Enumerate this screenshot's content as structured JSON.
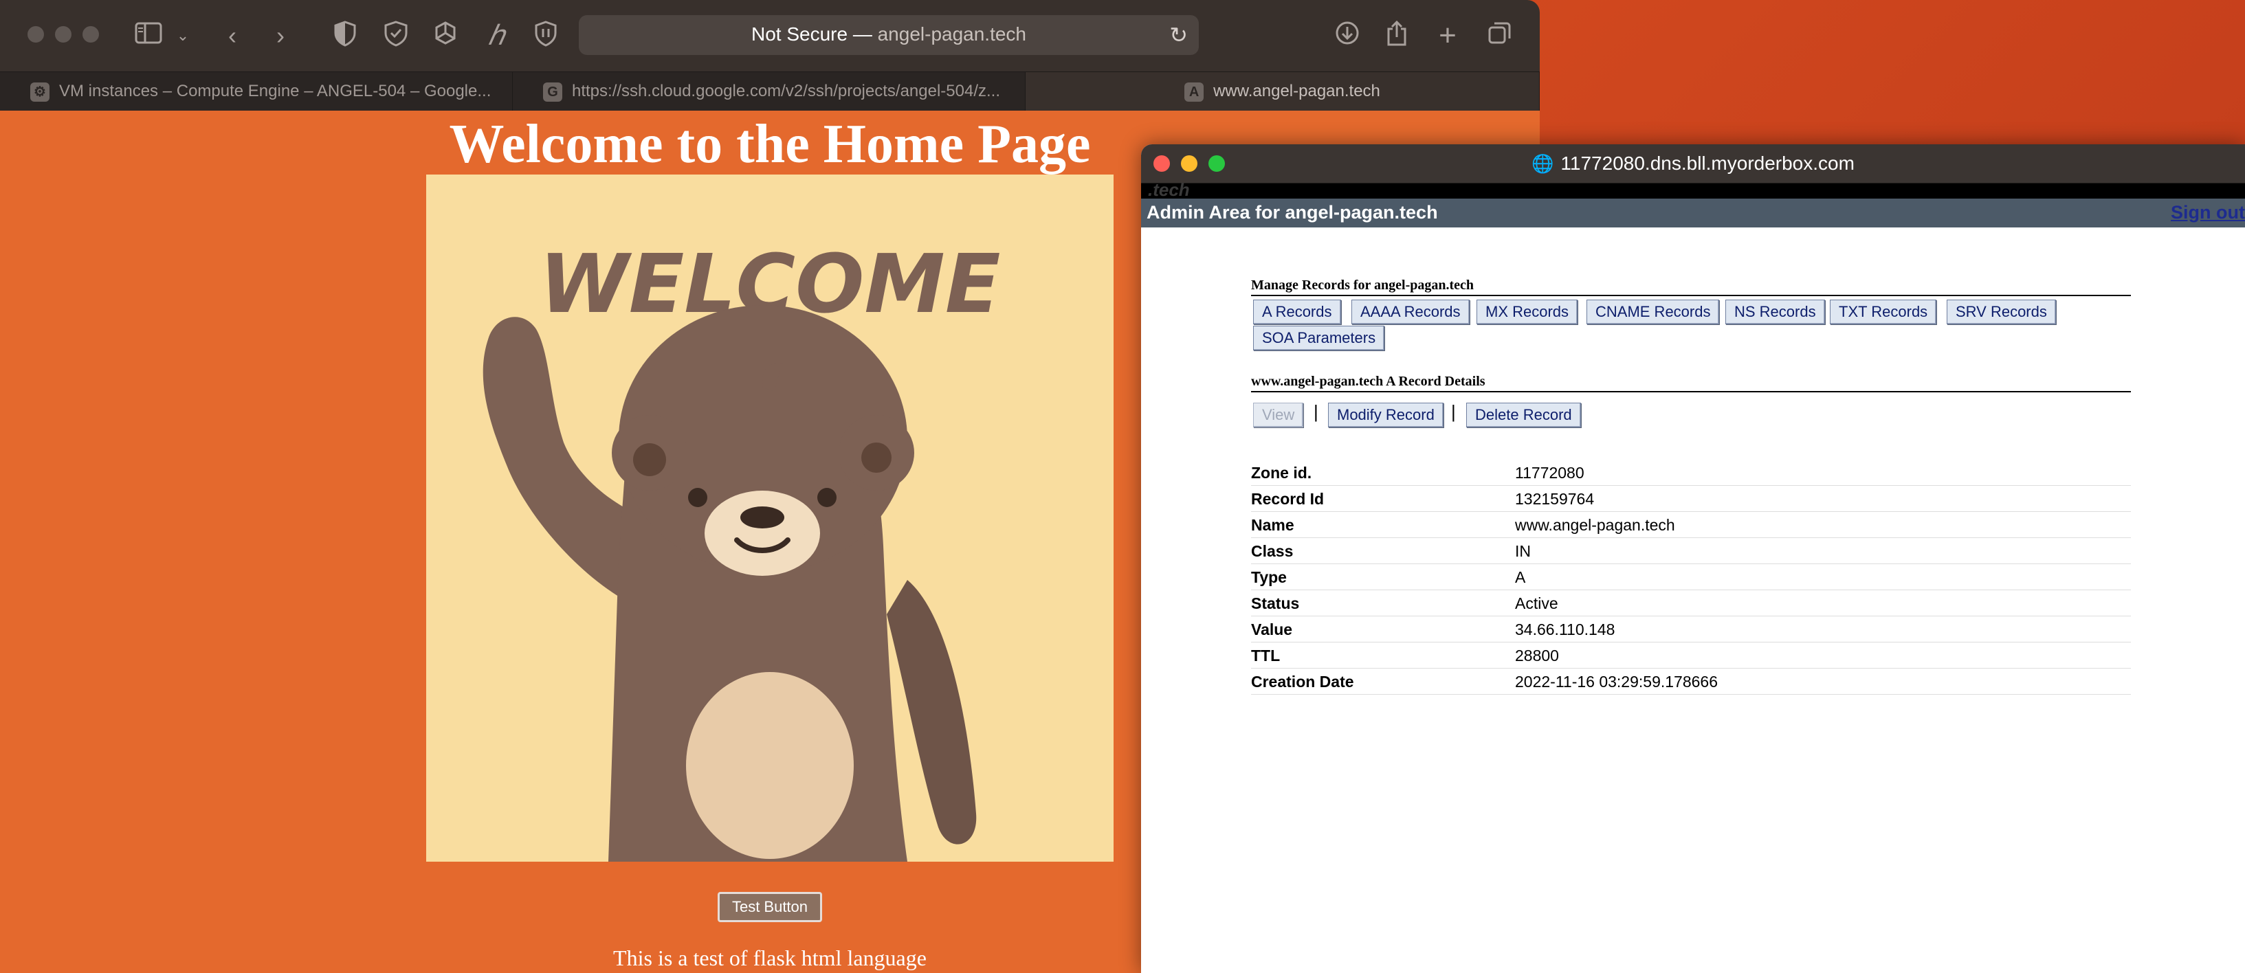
{
  "safari": {
    "address": {
      "prefix": "Not Secure —",
      "domain": "angel-pagan.tech"
    },
    "tabs": [
      {
        "label": "VM instances – Compute Engine – ANGEL-504 – Google...",
        "favicon": "gcp-icon"
      },
      {
        "label": "https://ssh.cloud.google.com/v2/ssh/projects/angel-504/z...",
        "favicon": "G"
      },
      {
        "label": "www.angel-pagan.tech",
        "favicon": "A"
      }
    ]
  },
  "page": {
    "heading": "Welcome to the Home Page",
    "image_text": "WELCOME",
    "button_label": "Test Button",
    "text": "This is a test of flask html language"
  },
  "dns": {
    "url": "11772080.dns.bll.myorderbox.com",
    "logo": ".tech",
    "admin_title": "Admin Area for angel-pagan.tech",
    "sign_out": "Sign out",
    "manage_heading": "Manage Records for angel-pagan.tech",
    "record_buttons": [
      "A Records",
      "AAAA Records",
      "MX Records",
      "CNAME Records",
      "NS Records",
      "TXT Records",
      "SRV Records",
      "SOA Parameters"
    ],
    "details_heading": "www.angel-pagan.tech A Record Details",
    "actions": {
      "view": "View",
      "separator": "|",
      "modify": "Modify Record",
      "delete": "Delete Record"
    },
    "details": [
      {
        "label": "Zone id.",
        "value": "11772080"
      },
      {
        "label": "Record Id",
        "value": "132159764"
      },
      {
        "label": "Name",
        "value": "www.angel-pagan.tech"
      },
      {
        "label": "Class",
        "value": "IN"
      },
      {
        "label": "Type",
        "value": "A"
      },
      {
        "label": "Status",
        "value": "Active"
      },
      {
        "label": "Value",
        "value": "34.66.110.148"
      },
      {
        "label": "TTL",
        "value": "28800"
      },
      {
        "label": "Creation Date",
        "value": "2022-11-16 03:29:59.178666"
      }
    ]
  },
  "colors": {
    "page_bg": "#e4692d",
    "image_bg": "#f9dd9f",
    "bear": "#7d6154",
    "admin_bar": "#4c5a68",
    "button_bg": "#dfe7f2"
  }
}
